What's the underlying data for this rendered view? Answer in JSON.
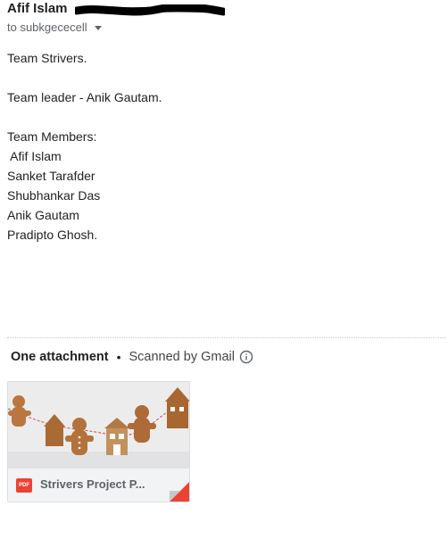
{
  "header": {
    "sender_name": "Afif Islam",
    "recipient_label": "to subkgececell"
  },
  "body": {
    "lines": [
      "Team Strivers.",
      "",
      "Team leader - Anik Gautam.",
      "",
      "Team Members:",
      " Afif Islam",
      "Sanket Tarafder",
      "Shubhankar Das",
      "Anik Gautam",
      "Pradipto Ghosh."
    ]
  },
  "attachments": {
    "title": "One attachment",
    "separator": "•",
    "scanned_label": "Scanned by Gmail",
    "files": [
      {
        "name": "Strivers Project P...",
        "type_badge": "PDF"
      }
    ]
  },
  "colors": {
    "pdf_red": "#ea4335",
    "text_dark": "#222222",
    "text_muted": "#5f6368"
  }
}
